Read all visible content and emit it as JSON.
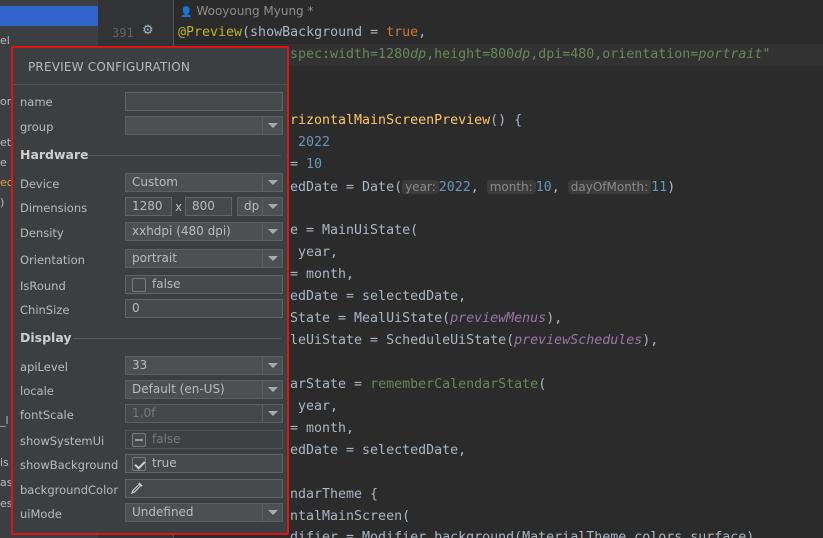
{
  "editor": {
    "author": "Wooyoung Myung *",
    "line_number": "391",
    "lines": {
      "l1": {
        "a": "@Preview",
        "b": "(showBackground = ",
        "c": "true",
        "d": ","
      },
      "l2": {
        "a": "spec:width=1280",
        "b": "dp",
        "c": ",height=800",
        "d": "dp",
        "e": ",dpi=480,orientation=",
        "f": "portrait",
        "g": "\""
      },
      "l3": {
        "a": "rizontalMainScreenPreview",
        "b": "() {"
      },
      "l4": {
        "a": "2022"
      },
      "l5": {
        "a": "= ",
        "b": "10"
      },
      "l6": {
        "a": "edDate = Date(",
        "h1": "year:",
        "b": "2022",
        "c": ", ",
        "h2": "month:",
        "d": "10",
        "e": ", ",
        "h3": "dayOfMonth:",
        "f": "11",
        "g": ")"
      },
      "l7": {
        "a": "e = MainUiState("
      },
      "l8": {
        "a": "year,"
      },
      "l9": {
        "a": "= month,"
      },
      "l10": {
        "a": "edDate = selectedDate,"
      },
      "l11": {
        "a": "State = MealUiState(",
        "b": "previewMenus",
        "c": "),"
      },
      "l12": {
        "a": "leUiState = ScheduleUiState(",
        "b": "previewSchedules",
        "c": "),"
      },
      "l13": {
        "a": "arState = ",
        "b": "rememberCalendarState",
        "c": "("
      },
      "l14": {
        "a": "year,"
      },
      "l15": {
        "a": "= month,"
      },
      "l16": {
        "a": "edDate = selectedDate,"
      },
      "l17": {
        "a": "ndarTheme {"
      },
      "l18": {
        "a": "ntalMainScreen("
      },
      "l19": {
        "a": "difier = Modifier.background(MaterialTheme.colors.surface)"
      }
    }
  },
  "left_strip": {
    "frag1": "el",
    "frag2": "or",
    "frag3": "et",
    "frag4": "e",
    "frag5": "ec",
    "frag6": ")",
    "frag7": "_l",
    "frag8": "is",
    "frag9": "as",
    "frag10": "es"
  },
  "popup": {
    "title": "PREVIEW CONFIGURATION",
    "rows": {
      "name": {
        "label": "name",
        "value": ""
      },
      "group": {
        "label": "group",
        "value": ""
      },
      "hardware": "Hardware",
      "device": {
        "label": "Device",
        "value": "Custom"
      },
      "dimensions": {
        "label": "Dimensions",
        "width": "1280",
        "sep": "x",
        "height": "800",
        "unit": "dp"
      },
      "density": {
        "label": "Density",
        "value": "xxhdpi (480 dpi)"
      },
      "orientation": {
        "label": "Orientation",
        "value": "portrait"
      },
      "isround": {
        "label": "IsRound",
        "value": "false"
      },
      "chinsize": {
        "label": "ChinSize",
        "value": "0"
      },
      "display": "Display",
      "apilevel": {
        "label": "apiLevel",
        "value": "33"
      },
      "locale": {
        "label": "locale",
        "value": "Default (en-US)"
      },
      "fontscale": {
        "label": "fontScale",
        "value": "1.0f"
      },
      "showsystemui": {
        "label": "showSystemUi",
        "value": "false"
      },
      "showbackground": {
        "label": "showBackground",
        "value": "true"
      },
      "backgroundcolor": {
        "label": "backgroundColor",
        "value": ""
      },
      "uimode": {
        "label": "uiMode",
        "value": "Undefined"
      }
    }
  },
  "colors": {
    "highlight_border": "#e01414",
    "popup_bg": "#3c3f41",
    "editor_bg": "#2b2b2b",
    "selection": "#2f65ca"
  }
}
